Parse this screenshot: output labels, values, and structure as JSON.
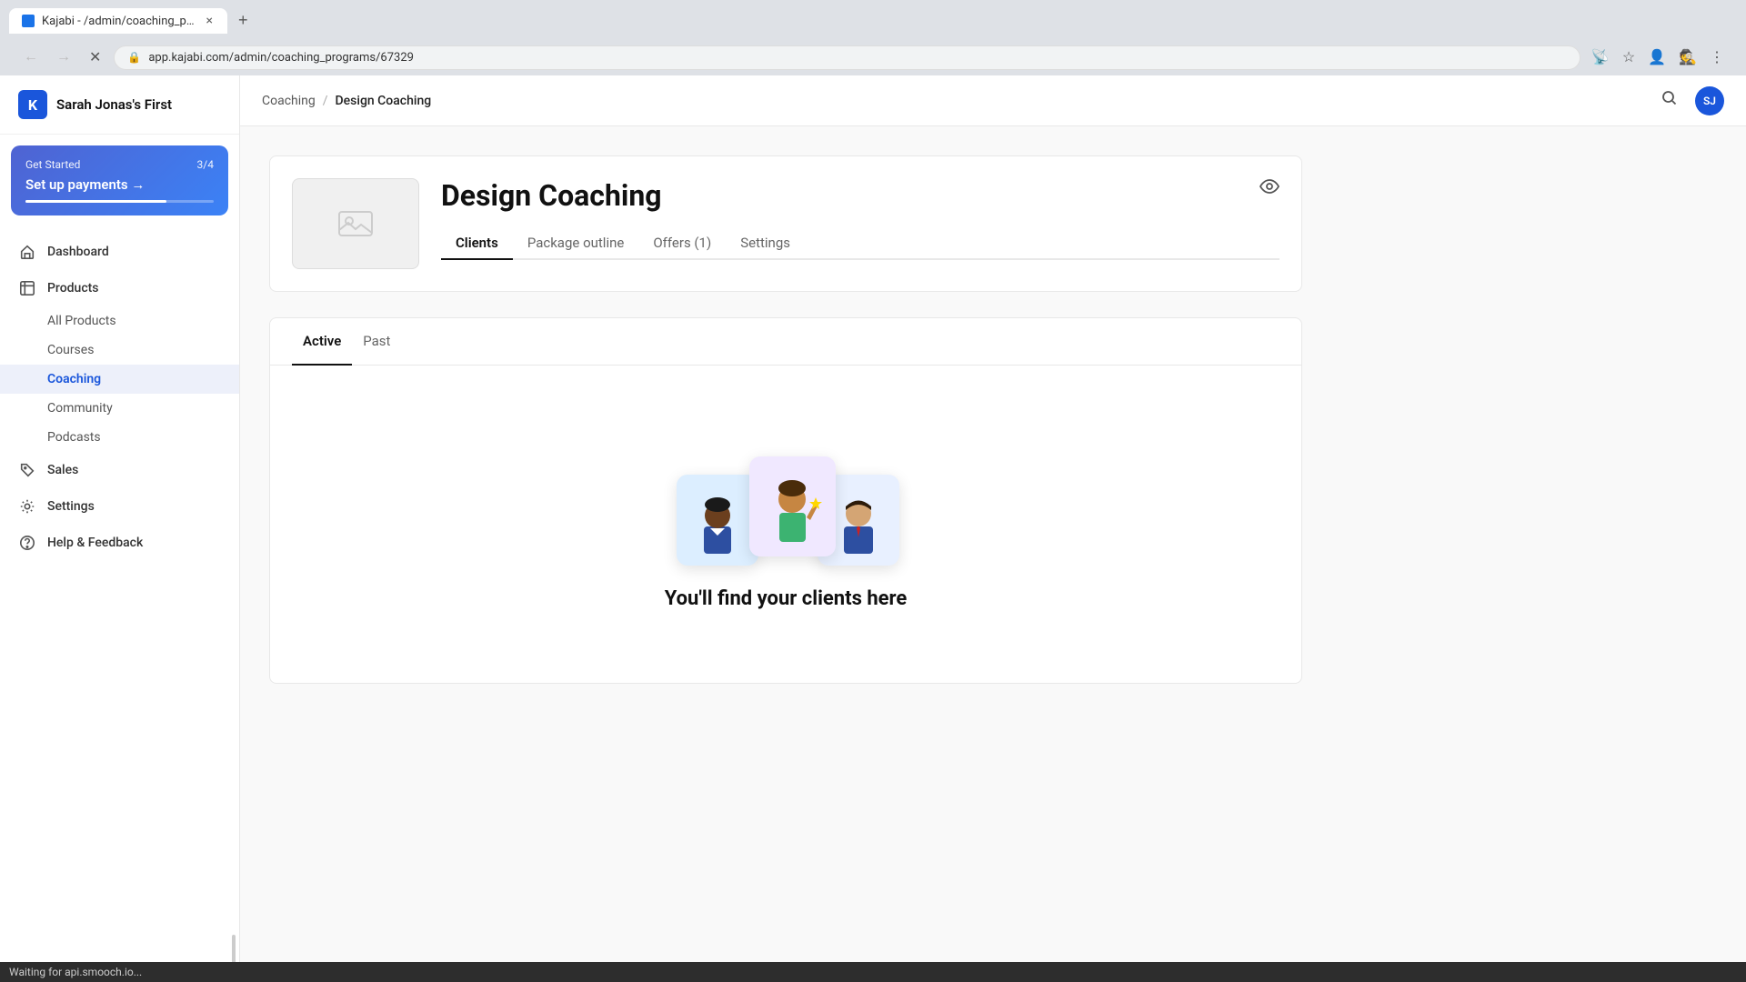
{
  "browser": {
    "tab_title": "Kajabi - /admin/coaching_progra...",
    "tab_close": "×",
    "tab_add": "+",
    "url": "app.kajabi.com/admin/coaching_programs/67329",
    "nav_back": "←",
    "nav_forward": "→",
    "nav_reload": "↻",
    "incognito_label": "Incognito"
  },
  "sidebar": {
    "logo_letter": "K",
    "brand_name": "Sarah Jonas's First",
    "get_started": {
      "label": "Get Started",
      "count": "3/4",
      "cta": "Set up payments →"
    },
    "nav_items": [
      {
        "id": "dashboard",
        "label": "Dashboard",
        "icon": "home"
      },
      {
        "id": "products",
        "label": "Products",
        "icon": "box"
      },
      {
        "id": "sales",
        "label": "Sales",
        "icon": "tag"
      },
      {
        "id": "settings",
        "label": "Settings",
        "icon": "gear"
      },
      {
        "id": "help",
        "label": "Help & Feedback",
        "icon": "help"
      }
    ],
    "products_sub": [
      {
        "id": "all-products",
        "label": "All Products"
      },
      {
        "id": "courses",
        "label": "Courses"
      },
      {
        "id": "coaching",
        "label": "Coaching",
        "active": true
      },
      {
        "id": "community",
        "label": "Community"
      },
      {
        "id": "podcasts",
        "label": "Podcasts"
      }
    ]
  },
  "topbar": {
    "breadcrumb_parent": "Coaching",
    "breadcrumb_separator": "/",
    "breadcrumb_current": "Design Coaching",
    "avatar_initials": "SJ"
  },
  "product": {
    "title": "Design Coaching",
    "tabs": [
      {
        "id": "clients",
        "label": "Clients",
        "active": true
      },
      {
        "id": "package-outline",
        "label": "Package outline"
      },
      {
        "id": "offers",
        "label": "Offers (1)"
      },
      {
        "id": "settings",
        "label": "Settings"
      }
    ]
  },
  "clients": {
    "tabs": [
      {
        "id": "active",
        "label": "Active",
        "active": true
      },
      {
        "id": "past",
        "label": "Past"
      }
    ],
    "empty_title": "You'll find your clients here"
  },
  "status_bar": {
    "text": "Waiting for api.smooch.io..."
  }
}
